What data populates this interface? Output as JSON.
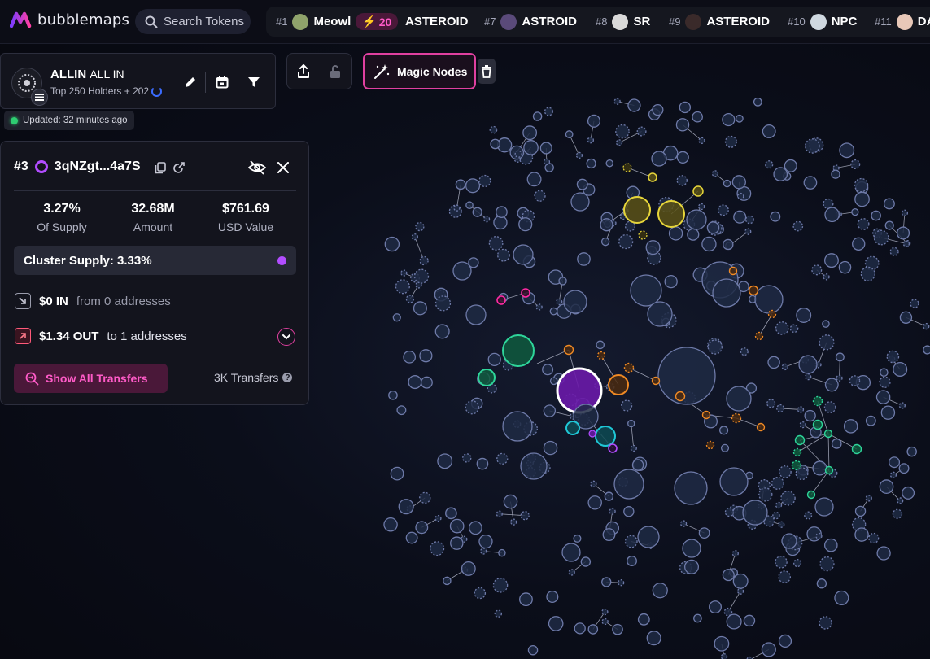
{
  "app": {
    "name": "bubblemaps",
    "brand_color": "#e040a0",
    "accent_purple": "#b24dff"
  },
  "search": {
    "placeholder": "Search Tokens"
  },
  "ticker": [
    {
      "rank": "#1",
      "name": "Meowl",
      "avatar_color": "#8fa36b",
      "boost": "20"
    },
    {
      "rank": "",
      "name": "ASTEROID",
      "avatar_color": ""
    },
    {
      "rank": "#7",
      "name": "ASTROID",
      "avatar_color": "#5a4a7a"
    },
    {
      "rank": "#8",
      "name": "SR",
      "avatar_color": "#d9d9d9"
    },
    {
      "rank": "#9",
      "name": "ASTEROID",
      "avatar_color": "#3a2a2a"
    },
    {
      "rank": "#10",
      "name": "NPC",
      "avatar_color": "#cfd8e0"
    },
    {
      "rank": "#11",
      "name": "DA",
      "avatar_color": "#e8c8b8"
    }
  ],
  "token": {
    "symbol": "ALLIN",
    "name": "ALL IN",
    "subtitle": "Top 250 Holders + 202",
    "updated": "Updated: 32 minutes ago",
    "chain_icon": "solana-icon"
  },
  "toolbar": {
    "magic_label": "Magic Nodes"
  },
  "wallet": {
    "rank": "#3",
    "address": "3qNZgt...4a7S",
    "stats": [
      {
        "value": "3.27%",
        "label": "Of Supply"
      },
      {
        "value": "32.68M",
        "label": "Amount"
      },
      {
        "value": "$761.69",
        "label": "USD Value"
      }
    ],
    "cluster_supply": "Cluster Supply: 3.33%",
    "in_amount": "$0 IN",
    "in_from": "from 0 addresses",
    "out_amount": "$1.34 OUT",
    "out_to": "to 1 addresses",
    "show_transfers": "Show All Transfers",
    "transfers_count": "3K Transfers"
  },
  "colors": {
    "node_fill": "#1e2a44",
    "node_stroke": "#6e7aa8",
    "yellow": "#e6d53a",
    "orange": "#f08a24",
    "green": "#2ed59a",
    "teal": "#1fc7d6",
    "magenta": "#ff2aa4",
    "purple": "#6a1aa8"
  }
}
